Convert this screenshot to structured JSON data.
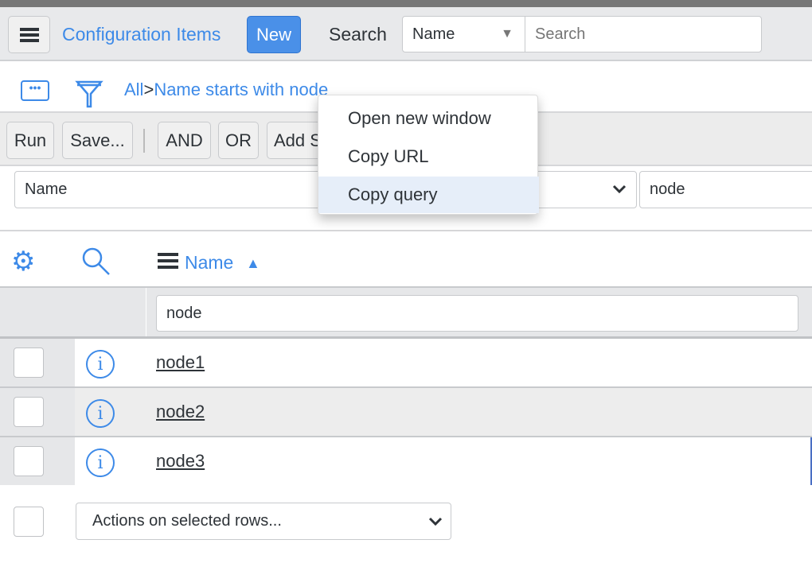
{
  "header": {
    "title": "Configuration Items",
    "new_label": "New",
    "search_label": "Search",
    "search_field": "Name",
    "search_placeholder": "Search"
  },
  "breadcrumb": {
    "all": "All",
    "separator": ">",
    "filter": "Name starts with node"
  },
  "toolbar": {
    "run": "Run",
    "save": "Save...",
    "and": "AND",
    "or": "OR",
    "add_sort": "Add Sort"
  },
  "condition": {
    "field": "Name",
    "value": "node"
  },
  "context_menu": {
    "items": [
      "Open new window",
      "Copy URL",
      "Copy query"
    ],
    "highlighted": "Copy query"
  },
  "list": {
    "column": "Name",
    "sort": "ascending",
    "filter_value": "node",
    "rows": [
      "node1",
      "node2",
      "node3"
    ]
  },
  "footer": {
    "actions": "Actions on selected rows..."
  },
  "colors": {
    "accent": "#3d8ae8",
    "new_button": "#4a90e8"
  }
}
